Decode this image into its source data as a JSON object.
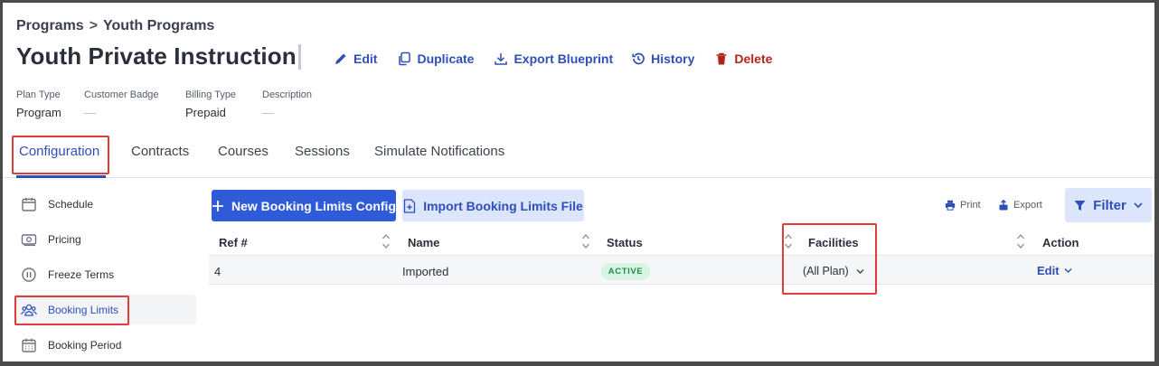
{
  "breadcrumb": {
    "parent": "Programs",
    "separator": ">",
    "current": "Youth Programs"
  },
  "page": {
    "title": "Youth Private Instruction",
    "actions": {
      "edit": "Edit",
      "duplicate": "Duplicate",
      "export_blueprint": "Export Blueprint",
      "history": "History",
      "delete": "Delete"
    }
  },
  "meta": {
    "plan_type": {
      "label": "Plan Type",
      "value": "Program"
    },
    "customer_badge": {
      "label": "Customer Badge",
      "value": "—"
    },
    "billing_type": {
      "label": "Billing Type",
      "value": "Prepaid"
    },
    "description": {
      "label": "Description",
      "value": "—"
    }
  },
  "tabs": [
    "Configuration",
    "Contracts",
    "Courses",
    "Sessions",
    "Simulate Notifications"
  ],
  "active_tab": "Configuration",
  "sidebar": {
    "items": [
      {
        "label": "Schedule",
        "icon": "calendar-icon"
      },
      {
        "label": "Pricing",
        "icon": "money-icon"
      },
      {
        "label": "Freeze Terms",
        "icon": "pause-circle-icon"
      },
      {
        "label": "Booking Limits",
        "icon": "users-icon"
      },
      {
        "label": "Booking Period",
        "icon": "calendar-grid-icon"
      }
    ],
    "active": "Booking Limits"
  },
  "toolbar": {
    "new_config": "New Booking Limits Config",
    "import_file": "Import Booking Limits File",
    "print": "Print",
    "export": "Export",
    "filter": "Filter"
  },
  "table": {
    "columns": [
      "Ref #",
      "Name",
      "Status",
      "Facilities",
      "Action"
    ],
    "rows": [
      {
        "ref": "4",
        "name": "Imported",
        "status": "ACTIVE",
        "facilities": "(All Plan)",
        "action": "Edit"
      }
    ]
  },
  "colors": {
    "accent": "#2f4fb8",
    "primary_button": "#2f5bd8",
    "secondary_button": "#dbe5fb",
    "danger": "#b42318",
    "status_active_bg": "#d9f4e3",
    "status_active_text": "#1f8a4c",
    "highlight_box": "#e03a3a"
  }
}
